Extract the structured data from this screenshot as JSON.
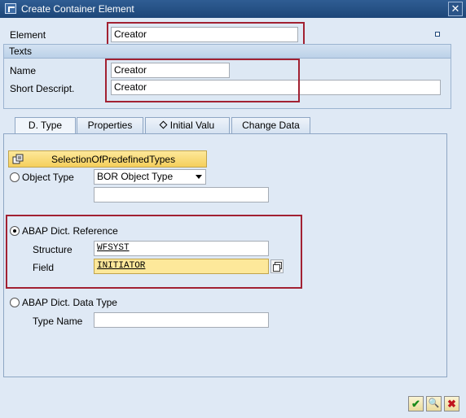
{
  "window": {
    "title": "Create Container Element",
    "close_icon": "✕"
  },
  "element": {
    "label": "Element",
    "value": "Creator"
  },
  "texts": {
    "header": "Texts",
    "name_label": "Name",
    "name_value": "Creator",
    "short_label": "Short Descript.",
    "short_value": "Creator"
  },
  "tabs": [
    {
      "label": "D. Type",
      "active": true
    },
    {
      "label": "Properties",
      "active": false
    },
    {
      "label": "Initial Valu",
      "active": false,
      "icon": "diamond-icon"
    },
    {
      "label": "Change Data",
      "active": false
    }
  ],
  "dtype": {
    "selection_button": "SelectionOfPredefinedTypes",
    "object_type_label": "Object Type",
    "object_type_select": "BOR Object Type",
    "object_type_value": "",
    "abap_ref_label": "ABAP Dict. Reference",
    "structure_label": "Structure",
    "structure_value": "WFSYST",
    "field_label": "Field",
    "field_value": "INITIATOR",
    "abap_type_label": "ABAP Dict. Data Type",
    "type_name_label": "Type Name",
    "type_name_value": "",
    "selected_option": "ABAP Dict. Reference"
  },
  "footer": {
    "confirm_icon": "✔",
    "search_icon": "🔍",
    "cancel_icon": "✖"
  },
  "colors": {
    "titlebar": "#1d4678",
    "highlight_box": "#a22132",
    "button_yellow": "#f5cf5c"
  }
}
